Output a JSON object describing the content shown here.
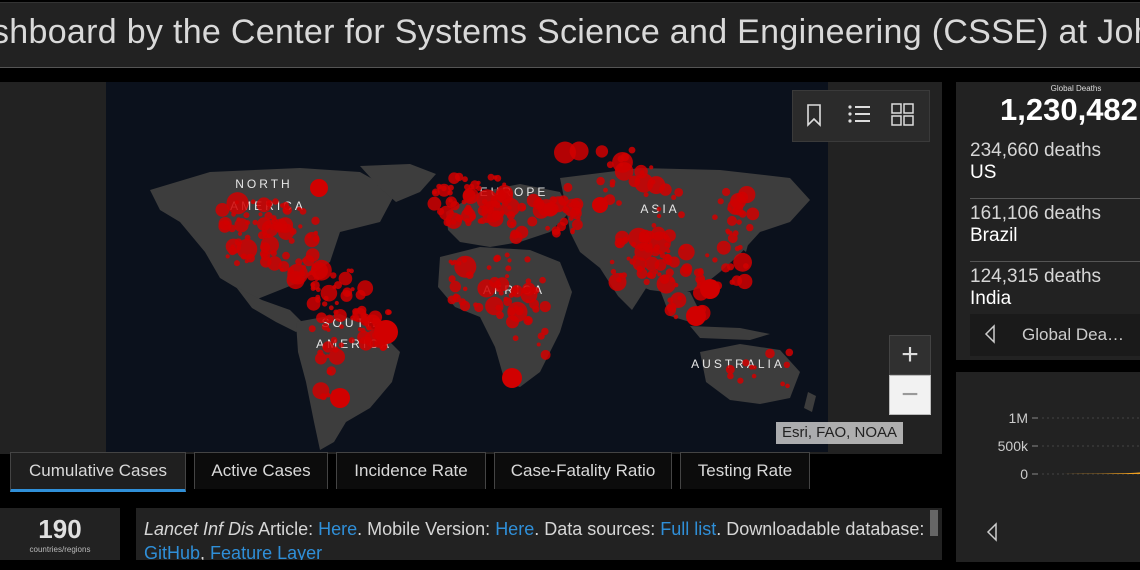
{
  "header": {
    "title": "shboard by the Center for Systems Science and Engineering (CSSE) at Johns"
  },
  "map": {
    "regions": [
      {
        "label": "NORTH",
        "x": 264,
        "y": 188
      },
      {
        "label": "AMERICA",
        "x": 268,
        "y": 210
      },
      {
        "label": "EUROPE",
        "x": 514,
        "y": 196
      },
      {
        "label": "ASIA",
        "x": 660,
        "y": 213
      },
      {
        "label": "AFRICA",
        "x": 514,
        "y": 294
      },
      {
        "label": "SOUTH",
        "x": 350,
        "y": 327
      },
      {
        "label": "AMERICA",
        "x": 354,
        "y": 348
      },
      {
        "label": "AUSTRALIA",
        "x": 738,
        "y": 368
      }
    ],
    "zoom_in_label": "+",
    "zoom_out_label": "−",
    "attribution": "Esri, FAO, NOAA",
    "icons": [
      "bookmark-icon",
      "list-icon",
      "basemap-gallery-icon"
    ],
    "case_color": "#d10000"
  },
  "tabs": [
    {
      "label": "Cumulative Cases",
      "active": true
    },
    {
      "label": "Active Cases",
      "active": false
    },
    {
      "label": "Incidence Rate",
      "active": false
    },
    {
      "label": "Case-Fatality Ratio",
      "active": false
    },
    {
      "label": "Testing Rate",
      "active": false
    }
  ],
  "summary": {
    "count": "190",
    "count_label": "countries/regions"
  },
  "info": {
    "article_title": "Lancet Inf Dis",
    "article_word": " Article: ",
    "article_link": "Here",
    "mobile_text": ". Mobile Version: ",
    "mobile_link": "Here",
    "sources_text": ". Data sources: ",
    "sources_link": "Full list",
    "download_text": ". Downloadable database: ",
    "github_link": "GitHub",
    "comma": ", ",
    "feature_link": "Feature Layer"
  },
  "deaths": {
    "label": "Global Deaths",
    "total": "1,230,482",
    "items": [
      {
        "count": "234,660 deaths",
        "country": "US"
      },
      {
        "count": "161,106 deaths",
        "country": "Brazil"
      },
      {
        "count": "124,315 deaths",
        "country": "India"
      }
    ],
    "nav_label": "Global Dea…"
  },
  "chart_data": {
    "type": "area",
    "yticks": [
      "1M",
      "500k",
      "0"
    ],
    "ylim": [
      0,
      1000000
    ],
    "color": "#f0a020",
    "x": [
      0,
      1,
      2,
      3,
      4,
      5,
      6,
      7,
      8,
      9,
      10
    ],
    "values": [
      0,
      0,
      0,
      2000,
      4000,
      6000,
      8000,
      10000,
      14000,
      22000,
      36000
    ]
  }
}
